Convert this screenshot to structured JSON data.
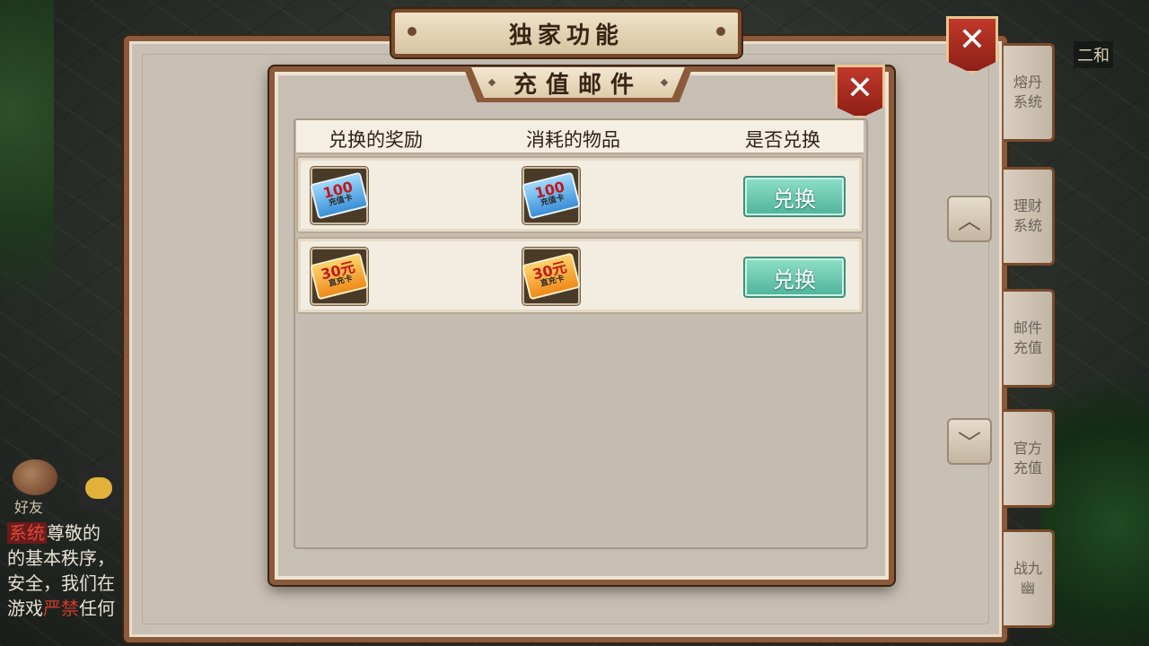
{
  "outer_panel": {
    "title": "独家功能"
  },
  "top_right_name": "二和",
  "side_tabs": [
    {
      "label": "熔丹\n系统"
    },
    {
      "label": "理财\n系统"
    },
    {
      "label": "邮件\n充值"
    },
    {
      "label": "官方\n充值"
    },
    {
      "label": "战九\n幽"
    }
  ],
  "friend_label": "好友",
  "chat": {
    "tag": "系统",
    "line1": "尊敬的",
    "line2": "的基本秩序，",
    "line3": "安全，我们在",
    "line4_prefix": "游戏",
    "line4_red": "严禁",
    "line4_suffix": "任何"
  },
  "dialog": {
    "title": "充值邮件",
    "columns": [
      "兑换的奖励",
      "消耗的物品",
      "是否兑换"
    ],
    "rows": [
      {
        "reward": {
          "big": "100",
          "small": "充值卡"
        },
        "cost": {
          "big": "100",
          "small": "充值卡"
        },
        "button": "兑换"
      },
      {
        "reward": {
          "big": "30元",
          "small": "直充卡"
        },
        "cost": {
          "big": "30元",
          "small": "直充卡"
        },
        "button": "兑换"
      }
    ]
  },
  "icons": {
    "close": "close-icon",
    "scroll_up": "chevron-up-icon",
    "scroll_down": "chevron-down-icon",
    "chat": "chat-bubble-icon"
  },
  "colors": {
    "frame_brown": "#8a5a3a",
    "button_teal": "#4fb39a",
    "close_red": "#c0392b"
  }
}
